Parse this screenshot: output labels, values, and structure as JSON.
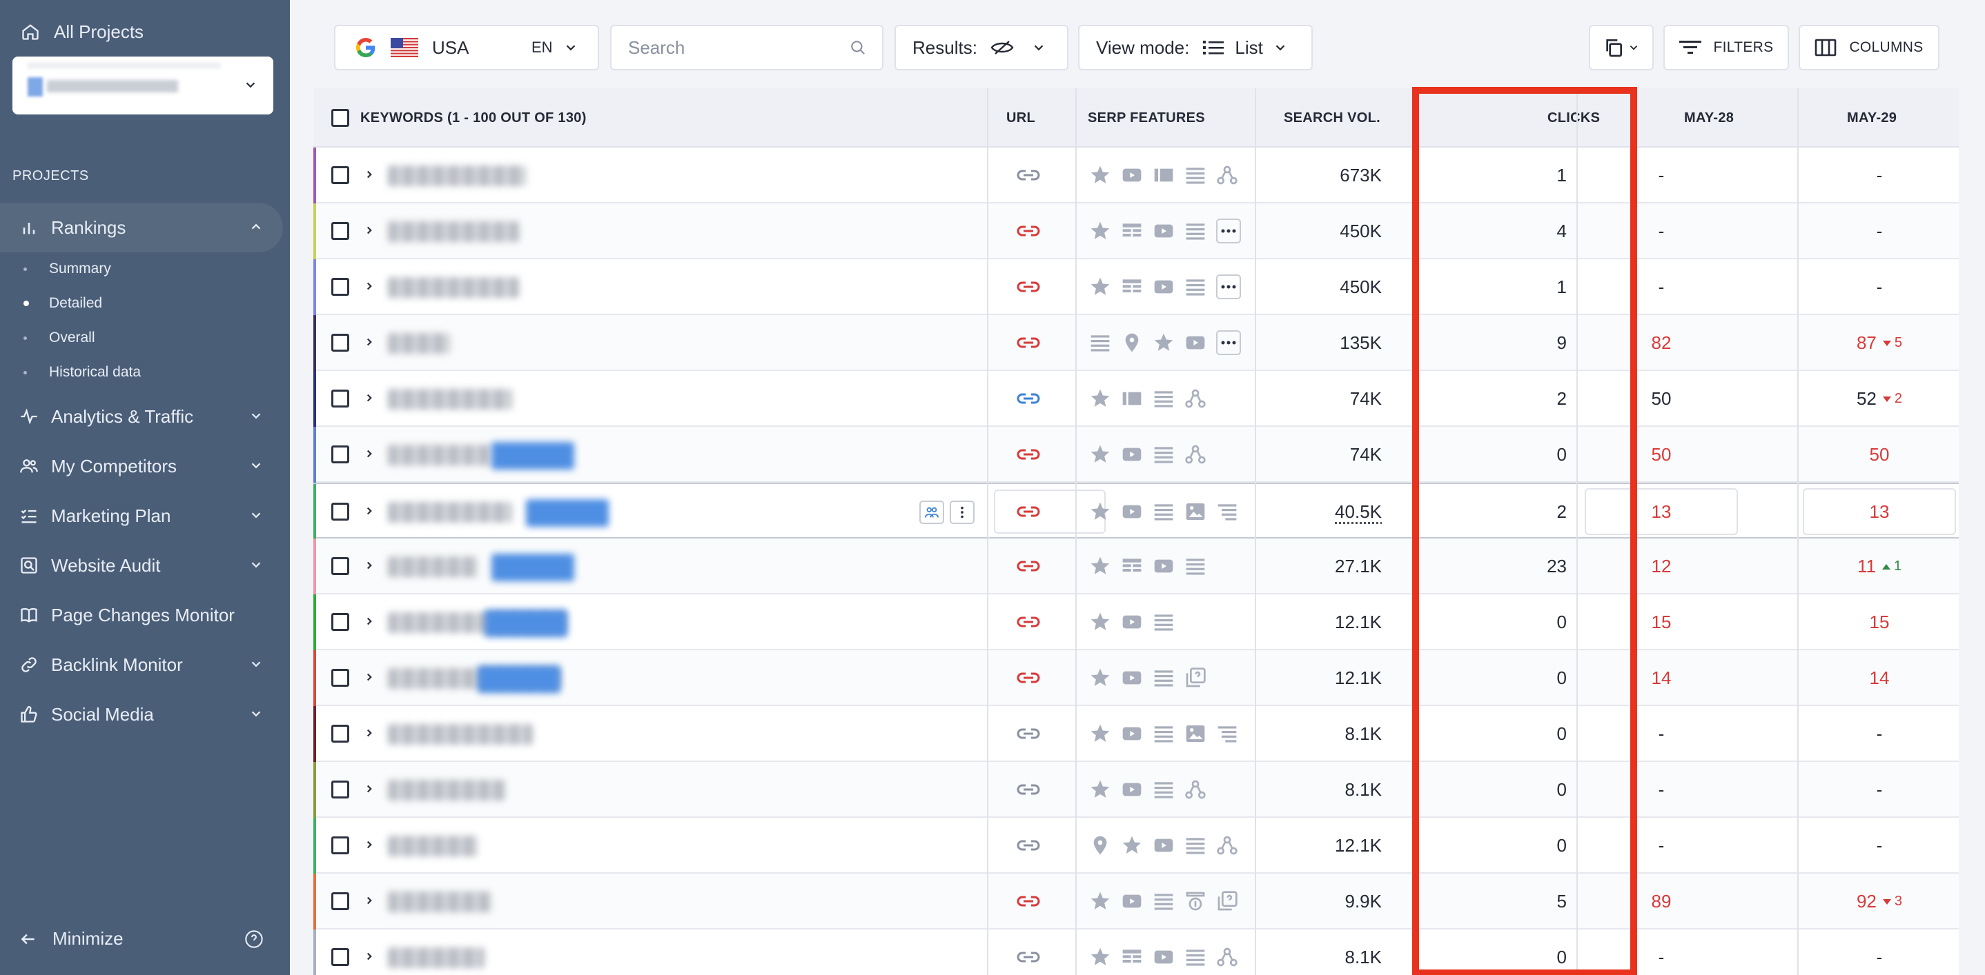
{
  "sidebar": {
    "all_projects": "All Projects",
    "section_label": "PROJECTS",
    "items": [
      {
        "label": "Rankings",
        "icon": "bar-chart-icon",
        "expanded": true
      },
      {
        "label": "Analytics & Traffic",
        "icon": "pulse-icon"
      },
      {
        "label": "My Competitors",
        "icon": "users-icon"
      },
      {
        "label": "Marketing Plan",
        "icon": "checklist-icon"
      },
      {
        "label": "Website Audit",
        "icon": "audit-icon"
      },
      {
        "label": "Page Changes Monitor",
        "icon": "book-icon"
      },
      {
        "label": "Backlink Monitor",
        "icon": "link-icon"
      },
      {
        "label": "Social Media",
        "icon": "thumbs-up-icon"
      }
    ],
    "subitems": [
      {
        "label": "Summary"
      },
      {
        "label": "Detailed",
        "active": true
      },
      {
        "label": "Overall"
      },
      {
        "label": "Historical data"
      }
    ],
    "minimize": "Minimize"
  },
  "toolbar": {
    "country": "USA",
    "language": "EN",
    "search_placeholder": "Search",
    "results_label": "Results:",
    "view_mode_label": "View mode:",
    "view_mode_value": "List",
    "filters_label": "FILTERS",
    "columns_label": "COLUMNS"
  },
  "table": {
    "headers": {
      "keywords": "KEYWORDS (1 - 100 OUT OF 130)",
      "url": "URL",
      "serp": "SERP FEATURES",
      "volume": "SEARCH VOL.",
      "clicks": "CLICKS",
      "date1": "MAY-28",
      "date2": "MAY-29"
    },
    "rows": [
      {
        "volume": "673K",
        "clicks": "1",
        "d1": "-",
        "d2": "-",
        "d2_delta": ""
      },
      {
        "volume": "450K",
        "clicks": "4",
        "d1": "-",
        "d2": "-",
        "d2_delta": ""
      },
      {
        "volume": "450K",
        "clicks": "1",
        "d1": "-",
        "d2": "-",
        "d2_delta": ""
      },
      {
        "volume": "135K",
        "clicks": "9",
        "d1": "82",
        "d2": "87",
        "d2_delta": "5"
      },
      {
        "volume": "74K",
        "clicks": "2",
        "d1": "50",
        "d2": "52",
        "d2_delta": "2"
      },
      {
        "volume": "74K",
        "clicks": "0",
        "d1": "50",
        "d2": "50",
        "d2_delta": ""
      },
      {
        "volume": "40.5K",
        "clicks": "2",
        "d1": "13",
        "d2": "13",
        "d2_delta": ""
      },
      {
        "volume": "27.1K",
        "clicks": "23",
        "d1": "12",
        "d2": "11",
        "d2_delta": "1"
      },
      {
        "volume": "12.1K",
        "clicks": "0",
        "d1": "15",
        "d2": "15",
        "d2_delta": ""
      },
      {
        "volume": "12.1K",
        "clicks": "0",
        "d1": "14",
        "d2": "14",
        "d2_delta": ""
      },
      {
        "volume": "8.1K",
        "clicks": "0",
        "d1": "-",
        "d2": "-",
        "d2_delta": ""
      },
      {
        "volume": "8.1K",
        "clicks": "0",
        "d1": "-",
        "d2": "-",
        "d2_delta": ""
      },
      {
        "volume": "12.1K",
        "clicks": "0",
        "d1": "-",
        "d2": "-",
        "d2_delta": ""
      },
      {
        "volume": "9.9K",
        "clicks": "5",
        "d1": "89",
        "d2": "92",
        "d2_delta": "3"
      },
      {
        "volume": "8.1K",
        "clicks": "0",
        "d1": "-",
        "d2": "-",
        "d2_delta": ""
      }
    ]
  },
  "colors": {
    "sidebar_bg": "#4b5e78",
    "accent_red": "#d83a3a",
    "highlight_frame": "#e8321e",
    "link_blue": "#3b82d6",
    "positive_green": "#2f8a4a"
  }
}
